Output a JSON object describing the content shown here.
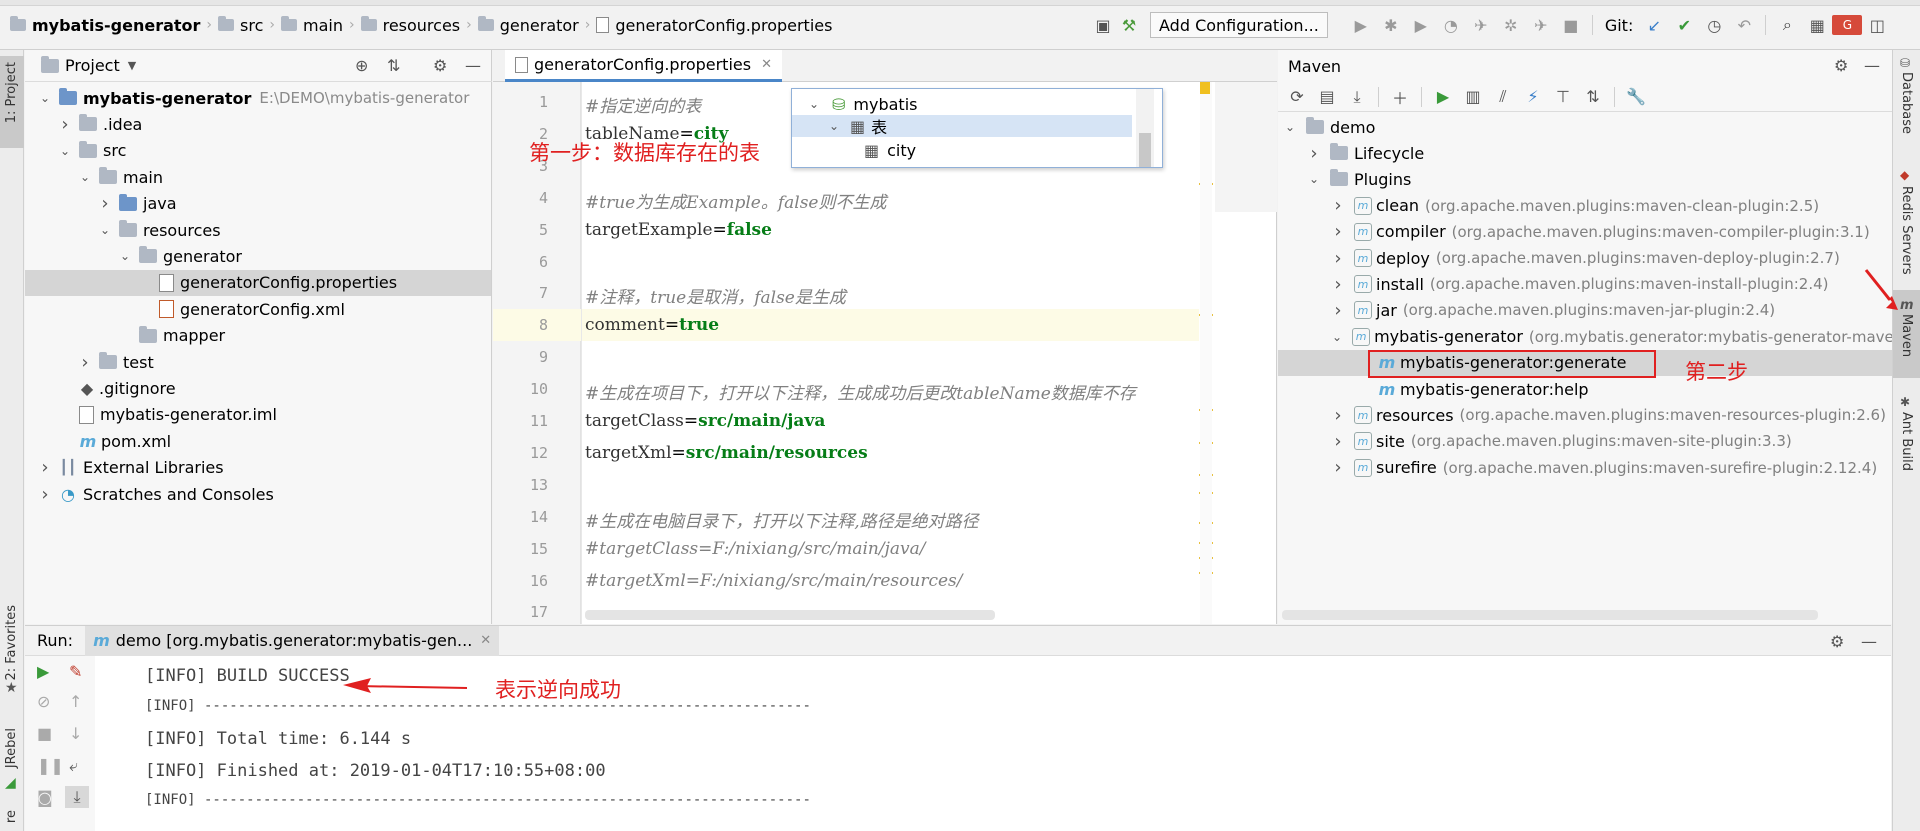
{
  "breadcrumb": [
    {
      "label": "mybatis-generator",
      "icon": "folder-icon",
      "bold": true
    },
    {
      "label": "src",
      "icon": "folder-icon"
    },
    {
      "label": "main",
      "icon": "folder-icon"
    },
    {
      "label": "resources",
      "icon": "folder-icon"
    },
    {
      "label": "generator",
      "icon": "folder-icon"
    },
    {
      "label": "generatorConfig.properties",
      "icon": "properties-file-icon"
    }
  ],
  "toolbar": {
    "run_config_label": "Add Configuration...",
    "git_label": "Git:"
  },
  "project_panel": {
    "title": "Project",
    "tree": [
      {
        "label": "mybatis-generator",
        "suffix": "E:\\DEMO\\mybatis-generator",
        "depth": 0,
        "expanded": true,
        "icon": "module-folder-icon",
        "bold": true
      },
      {
        "label": ".idea",
        "depth": 1,
        "expanded": false,
        "icon": "folder-icon"
      },
      {
        "label": "src",
        "depth": 1,
        "expanded": true,
        "icon": "folder-icon"
      },
      {
        "label": "main",
        "depth": 2,
        "expanded": true,
        "icon": "folder-icon"
      },
      {
        "label": "java",
        "depth": 3,
        "expanded": false,
        "icon": "source-folder-icon"
      },
      {
        "label": "resources",
        "depth": 3,
        "expanded": true,
        "icon": "resources-folder-icon"
      },
      {
        "label": "generator",
        "depth": 4,
        "expanded": true,
        "icon": "folder-icon"
      },
      {
        "label": "generatorConfig.properties",
        "depth": 5,
        "icon": "properties-file-icon",
        "selected": true
      },
      {
        "label": "generatorConfig.xml",
        "depth": 5,
        "icon": "xml-file-icon"
      },
      {
        "label": "mapper",
        "depth": 4,
        "icon": "folder-icon"
      },
      {
        "label": "test",
        "depth": 2,
        "expanded": false,
        "icon": "folder-icon"
      },
      {
        "label": ".gitignore",
        "depth": 1,
        "icon": "gitignore-icon"
      },
      {
        "label": "mybatis-generator.iml",
        "depth": 1,
        "icon": "iml-file-icon"
      },
      {
        "label": "pom.xml",
        "depth": 1,
        "icon": "maven-icon"
      },
      {
        "label": "External Libraries",
        "depth": 0,
        "expanded": false,
        "icon": "libraries-icon"
      },
      {
        "label": "Scratches and Consoles",
        "depth": 0,
        "expanded": false,
        "icon": "scratches-icon"
      }
    ]
  },
  "editor": {
    "tab_label": "generatorConfig.properties",
    "lines": [
      {
        "n": "1",
        "comment": "#指定逆向的表"
      },
      {
        "n": "2",
        "key": "tableName",
        "value": "city"
      },
      {
        "n": "3"
      },
      {
        "n": "4",
        "comment": "#true为生成Example。false则不生成"
      },
      {
        "n": "5",
        "key": "targetExample",
        "value": "false"
      },
      {
        "n": "6"
      },
      {
        "n": "7",
        "comment": "#注释，true是取消，false是生成"
      },
      {
        "n": "8",
        "key": "comment",
        "value": "true",
        "current": true
      },
      {
        "n": "9"
      },
      {
        "n": "10",
        "comment": "#生成在项目下，打开以下注释，生成成功后更改tableName数据库不存"
      },
      {
        "n": "11",
        "key": "targetClass",
        "value": "src/main/java"
      },
      {
        "n": "12",
        "key": "targetXml",
        "value": "src/main/resources"
      },
      {
        "n": "13"
      },
      {
        "n": "14",
        "comment": "#生成在电脑目录下，打开以下注释,路径是绝对路径"
      },
      {
        "n": "15",
        "comment": "#targetClass=F:/nixiang/src/main/java/"
      },
      {
        "n": "16",
        "comment": "#targetXml=F:/nixiang/src/main/resources/"
      },
      {
        "n": "17"
      }
    ],
    "popup": {
      "items": [
        {
          "label": "mybatis",
          "icon": "database-icon"
        },
        {
          "label": "表",
          "icon": "table-icon"
        },
        {
          "label": "city",
          "icon": "table-icon"
        }
      ]
    },
    "annotation_step1": "第一步：数据库存在的表"
  },
  "maven_panel": {
    "title": "Maven",
    "tree": [
      {
        "label": "demo",
        "depth": 0,
        "expanded": true,
        "icon": "maven-project-icon"
      },
      {
        "label": "Lifecycle",
        "depth": 1,
        "expanded": false,
        "icon": "folder-gear-icon"
      },
      {
        "label": "Plugins",
        "depth": 1,
        "expanded": true,
        "icon": "folder-gear-icon"
      },
      {
        "label": "clean",
        "detail": "(org.apache.maven.plugins:maven-clean-plugin:2.5)",
        "depth": 2,
        "expanded": false,
        "icon": "plugin-icon"
      },
      {
        "label": "compiler",
        "detail": "(org.apache.maven.plugins:maven-compiler-plugin:3.1)",
        "depth": 2,
        "expanded": false,
        "icon": "plugin-icon"
      },
      {
        "label": "deploy",
        "detail": "(org.apache.maven.plugins:maven-deploy-plugin:2.7)",
        "depth": 2,
        "expanded": false,
        "icon": "plugin-icon"
      },
      {
        "label": "install",
        "detail": "(org.apache.maven.plugins:maven-install-plugin:2.4)",
        "depth": 2,
        "expanded": false,
        "icon": "plugin-icon"
      },
      {
        "label": "jar",
        "detail": "(org.apache.maven.plugins:maven-jar-plugin:2.4)",
        "depth": 2,
        "expanded": false,
        "icon": "plugin-icon"
      },
      {
        "label": "mybatis-generator",
        "detail": "(org.mybatis.generator:mybatis-generator-maven-p",
        "depth": 2,
        "expanded": true,
        "icon": "plugin-icon"
      },
      {
        "label": "mybatis-generator:generate",
        "depth": 3,
        "icon": "goal-icon",
        "selected": true
      },
      {
        "label": "mybatis-generator:help",
        "depth": 3,
        "icon": "goal-icon"
      },
      {
        "label": "resources",
        "detail": "(org.apache.maven.plugins:maven-resources-plugin:2.6)",
        "depth": 2,
        "expanded": false,
        "icon": "plugin-icon"
      },
      {
        "label": "site",
        "detail": "(org.apache.maven.plugins:maven-site-plugin:3.3)",
        "depth": 2,
        "expanded": false,
        "icon": "plugin-icon"
      },
      {
        "label": "surefire",
        "detail": "(org.apache.maven.plugins:maven-surefire-plugin:2.12.4)",
        "depth": 2,
        "expanded": false,
        "icon": "plugin-icon"
      }
    ],
    "annotation_step2": "第二步"
  },
  "right_tabs": [
    "Database",
    "Redis Servers",
    "Maven",
    "Ant Build"
  ],
  "left_tabs": [
    "1: Project",
    "2: Favorites",
    "JRebel",
    "re"
  ],
  "run_panel": {
    "label": "Run:",
    "tab_label": "demo [org.mybatis.generator:mybatis-gen...",
    "lines": [
      "[INFO] BUILD SUCCESS",
      "[INFO] ------------------------------------------------------------------------",
      "[INFO] Total time: 6.144 s",
      "[INFO] Finished at: 2019-01-04T17:10:55+08:00",
      "[INFO] ------------------------------------------------------------------------"
    ],
    "annotation_success": "表示逆向成功"
  },
  "colors": {
    "accent_red": "#e02020",
    "selection_gray": "#d5d5d5",
    "current_line": "#fdfbe6",
    "green": "#067d17"
  }
}
